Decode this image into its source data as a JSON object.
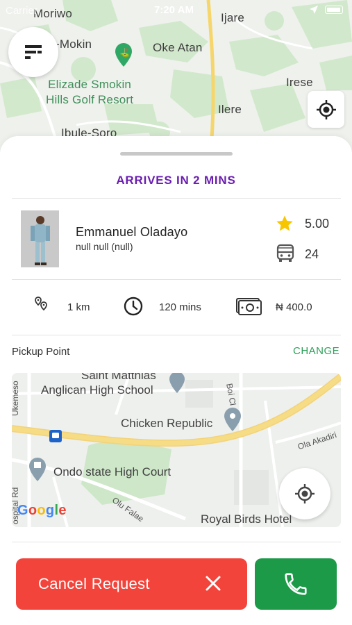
{
  "status_bar": {
    "carrier": "Carrier",
    "time": "7:20 AM"
  },
  "top_map": {
    "labels": {
      "moriwo": "Moriwo",
      "mokin": "-Mokin",
      "oke_atan": "Oke Atan",
      "ijare": "Ijare",
      "irese": "Irese",
      "ilere": "Ilere",
      "golf_line1": "Elizade Smokin",
      "golf_line2": "Hills Golf Resort",
      "ibule": "Ibule-Soro"
    }
  },
  "sheet": {
    "arrival_text": "ARRIVES IN 2 MINS",
    "driver": {
      "name": "Emmanuel Oladayo",
      "vehicle": "null null (null)",
      "rating": "5.00",
      "seats": "24"
    },
    "trip": {
      "distance": "1 km",
      "duration": "120 mins",
      "fare": "₦ 400.0"
    },
    "pickup": {
      "label": "Pickup Point",
      "change": "CHANGE"
    },
    "mini_map": {
      "labels": {
        "saint": "Saint Matthias",
        "anglican": "Anglican High School",
        "chicken": "Chicken Republic",
        "ondo": "Ondo state High Court",
        "royal": "Royal Birds Hotel",
        "boi": "Boi Cl",
        "ola": "Ola Akadiri",
        "ukemeso": "Ukemeso",
        "ospital": "ospital Rd",
        "olu": "Olu Falae"
      },
      "google": [
        "G",
        "o",
        "o",
        "g",
        "l",
        "e"
      ]
    },
    "actions": {
      "cancel": "Cancel Request"
    }
  },
  "colors": {
    "accent_purple": "#6a1db0",
    "cancel_red": "#f2443b",
    "call_green": "#1c9a48",
    "change_green": "#2ea05a",
    "star_yellow": "#f7c600"
  },
  "icons": [
    "menu-icon",
    "my-location-icon",
    "star-icon",
    "bus-icon",
    "location-pins-icon",
    "clock-icon",
    "cash-icon",
    "close-icon",
    "phone-icon",
    "golf-icon"
  ]
}
